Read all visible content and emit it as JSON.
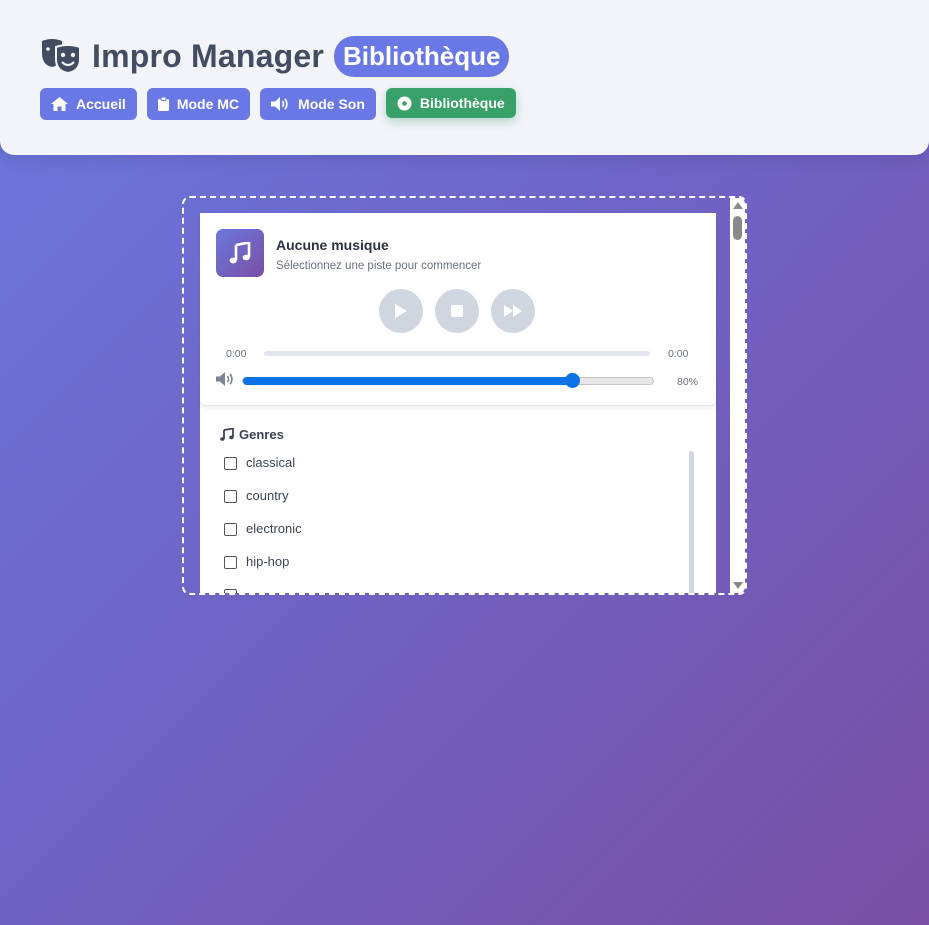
{
  "header": {
    "app_title": "Impro Manager",
    "page_badge": "Bibliothèque",
    "logo_icon": "theater-masks-icon",
    "nav": [
      {
        "label": "Accueil",
        "icon": "home-icon",
        "active": false
      },
      {
        "label": "Mode MC",
        "icon": "clipboard-icon",
        "active": false
      },
      {
        "label": "Mode Son",
        "icon": "volume-icon",
        "active": false
      },
      {
        "label": "Bibliothèque",
        "icon": "disc-icon",
        "active": true
      }
    ]
  },
  "player": {
    "title": "Aucune musique",
    "subtitle": "Sélectionnez une piste pour commencer",
    "time_current": "0:00",
    "time_total": "0:00",
    "progress": 0,
    "volume_percent": 80,
    "volume_label": "80%",
    "controls": [
      "play-icon",
      "stop-icon",
      "fast-forward-icon"
    ]
  },
  "genres": {
    "title": "Genres",
    "items": [
      "classical",
      "country",
      "electronic",
      "hip-hop"
    ]
  },
  "colors": {
    "accent": "#6a78e6",
    "active_nav": "#38a169",
    "slider": "#0a73e8"
  }
}
